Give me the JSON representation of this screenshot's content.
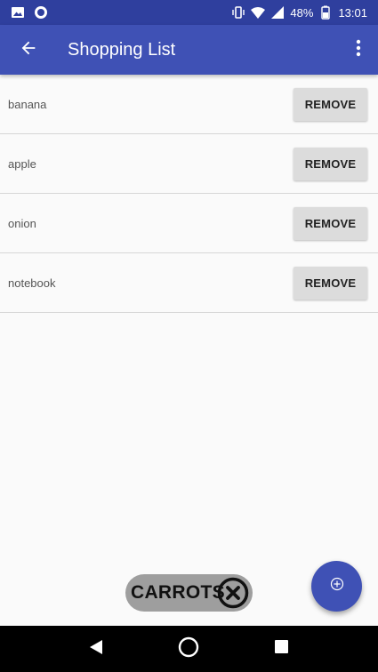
{
  "status_bar": {
    "icons_left": [
      "image-icon",
      "record-icon"
    ],
    "icons_right": [
      "vibrate-icon",
      "wifi-icon",
      "signal-icon"
    ],
    "battery_text": "48%",
    "time": "13:01"
  },
  "app_bar": {
    "title": "Shopping List",
    "back_icon": "arrow-back-icon",
    "menu_icon": "more-vert-icon"
  },
  "items": [
    {
      "label": "banana",
      "button": "REMOVE"
    },
    {
      "label": "apple",
      "button": "REMOVE"
    },
    {
      "label": "onion",
      "button": "REMOVE"
    },
    {
      "label": "notebook",
      "button": "REMOVE"
    }
  ],
  "chip": {
    "label": "CARROTS",
    "icon": "close-circle-icon"
  },
  "fab": {
    "icon": "add-circle-icon"
  },
  "colors": {
    "primary": "#3f51b5",
    "status_bar": "#2f3f9e",
    "button_bg": "#dcdcdc",
    "chip_bg": "#9e9e9e"
  }
}
